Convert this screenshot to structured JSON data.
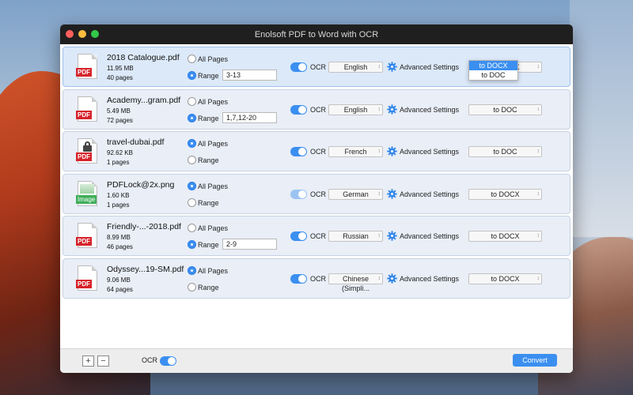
{
  "window": {
    "title": "Enolsoft PDF to Word with OCR"
  },
  "files": [
    {
      "name": "2018 Catalogue.pdf",
      "size": "11.95 MB",
      "pages": "40 pages",
      "icon": "pdf-icon",
      "icon_tag": "PDF",
      "page_mode": "range",
      "range": "3-13",
      "ocr": true,
      "language": "English",
      "format": "to DOCX",
      "dropdown_open": true
    },
    {
      "name": "Academy...gram.pdf",
      "size": "5.49 MB",
      "pages": "72 pages",
      "icon": "pdf-icon",
      "icon_tag": "PDF",
      "page_mode": "range",
      "range": "1,7,12-20",
      "ocr": true,
      "language": "English",
      "format": "to DOC"
    },
    {
      "name": "travel-dubai.pdf",
      "size": "92.62 KB",
      "pages": "1 pages",
      "icon": "locked-pdf-icon",
      "icon_tag": "PDF",
      "page_mode": "all",
      "range": "",
      "ocr": true,
      "language": "French",
      "format": "to DOC"
    },
    {
      "name": "PDFLock@2x.png",
      "size": "1.60 KB",
      "pages": "1 pages",
      "icon": "image-file-icon",
      "icon_tag": "Image",
      "page_mode": "all",
      "range": "",
      "ocr": true,
      "language": "German",
      "format": "to DOCX"
    },
    {
      "name": "Friendly-...-2018.pdf",
      "size": "8.99 MB",
      "pages": "46 pages",
      "icon": "pdf-icon",
      "icon_tag": "PDF",
      "page_mode": "range",
      "range": "2-9",
      "ocr": true,
      "language": "Russian",
      "format": "to DOCX"
    },
    {
      "name": "Odyssey...19-SM.pdf",
      "size": "9.06 MB",
      "pages": "64 pages",
      "icon": "pdf-icon",
      "icon_tag": "PDF",
      "page_mode": "all",
      "range": "",
      "ocr": true,
      "language": "Chinese (Simpli...",
      "format": "to DOCX"
    }
  ],
  "labels": {
    "all_pages": "All Pages",
    "range": "Range",
    "ocr": "OCR",
    "advanced": "Advanced Settings"
  },
  "format_options": [
    "to DOCX",
    "to DOC"
  ],
  "footer": {
    "add": "+",
    "remove": "−",
    "ocr": "OCR",
    "convert": "Convert"
  },
  "colors": {
    "accent": "#3b8ff0",
    "pdf_tag": "#d6232b",
    "image_tag": "#3fae5a"
  }
}
